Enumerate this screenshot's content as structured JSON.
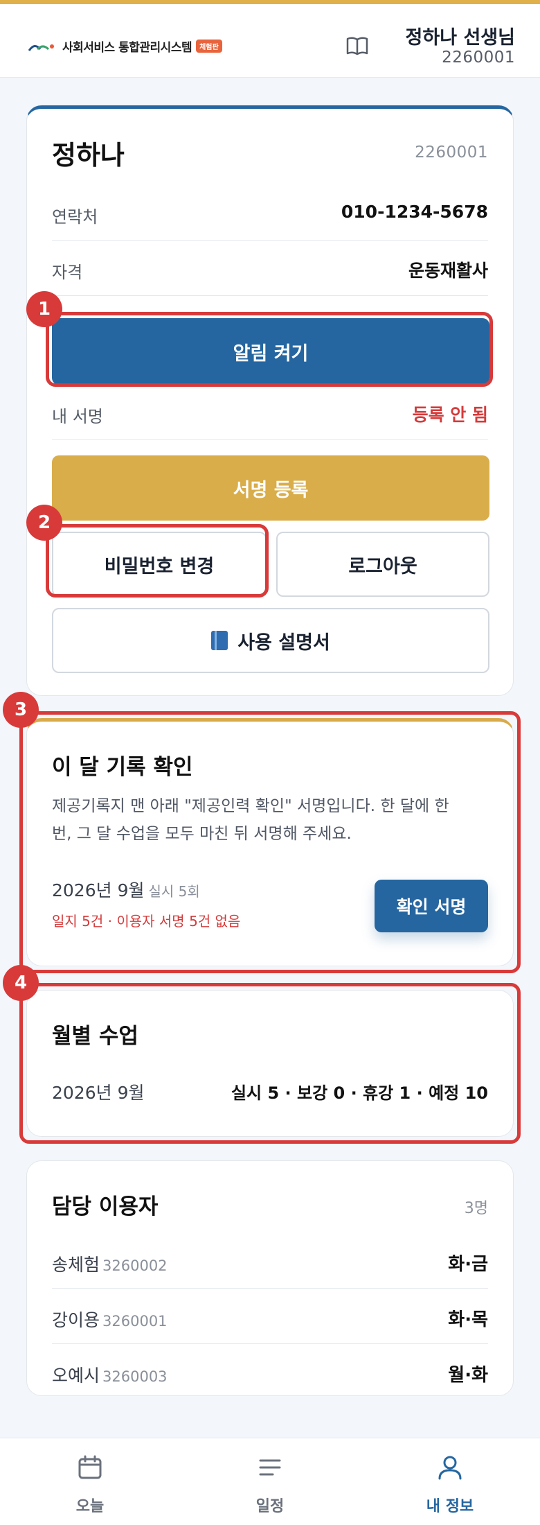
{
  "header": {
    "app_name": "사회서비스 통합관리시스템",
    "badge": "체험판",
    "user_name": "정하나 선생님",
    "user_id": "2260001"
  },
  "profile": {
    "name": "정하나",
    "id": "2260001",
    "rows": [
      {
        "label": "연락처",
        "value": "010-1234-5678"
      },
      {
        "label": "자격",
        "value": "운동재활사"
      }
    ],
    "alarm_button": "알림 켜기",
    "signature_label": "내 서명",
    "signature_status": "등록 안 됨",
    "signature_button": "서명 등록",
    "password_button": "비밀번호 변경",
    "logout_button": "로그아웃",
    "manual_button": "사용 설명서"
  },
  "monthly_confirm": {
    "title": "이 달 기록 확인",
    "description": "제공기록지 맨 아래 \"제공인력 확인\" 서명입니다. 한 달에 한 번, 그 달 수업을 모두 마친 뒤 서명해 주세요.",
    "month": "2026년 9월",
    "count": "실시 5회",
    "warning": "일지 5건 · 이용자 서명 5건 없음",
    "button": "확인 서명"
  },
  "monthly_classes": {
    "title": "월별 수업",
    "month": "2026년 9월",
    "stats": "실시 5 · 보강 0 · 휴강 1 · 예정 10"
  },
  "clients": {
    "title": "담당 이용자",
    "count": "3명",
    "items": [
      {
        "name": "송체험",
        "id": "3260002",
        "days": "화·금"
      },
      {
        "name": "강이용",
        "id": "3260001",
        "days": "화·목"
      },
      {
        "name": "오예시",
        "id": "3260003",
        "days": "월·화"
      }
    ]
  },
  "annotations": [
    "1",
    "2",
    "3",
    "4"
  ],
  "nav": {
    "items": [
      {
        "label": "오늘",
        "icon": "calendar-icon"
      },
      {
        "label": "일정",
        "icon": "list-icon"
      },
      {
        "label": "내 정보",
        "icon": "person-icon"
      }
    ],
    "active": "내 정보"
  },
  "colors": {
    "primary": "#2566a0",
    "gold": "#d9ad4a",
    "highlight": "#d83a3a",
    "danger": "#d43b3b"
  }
}
